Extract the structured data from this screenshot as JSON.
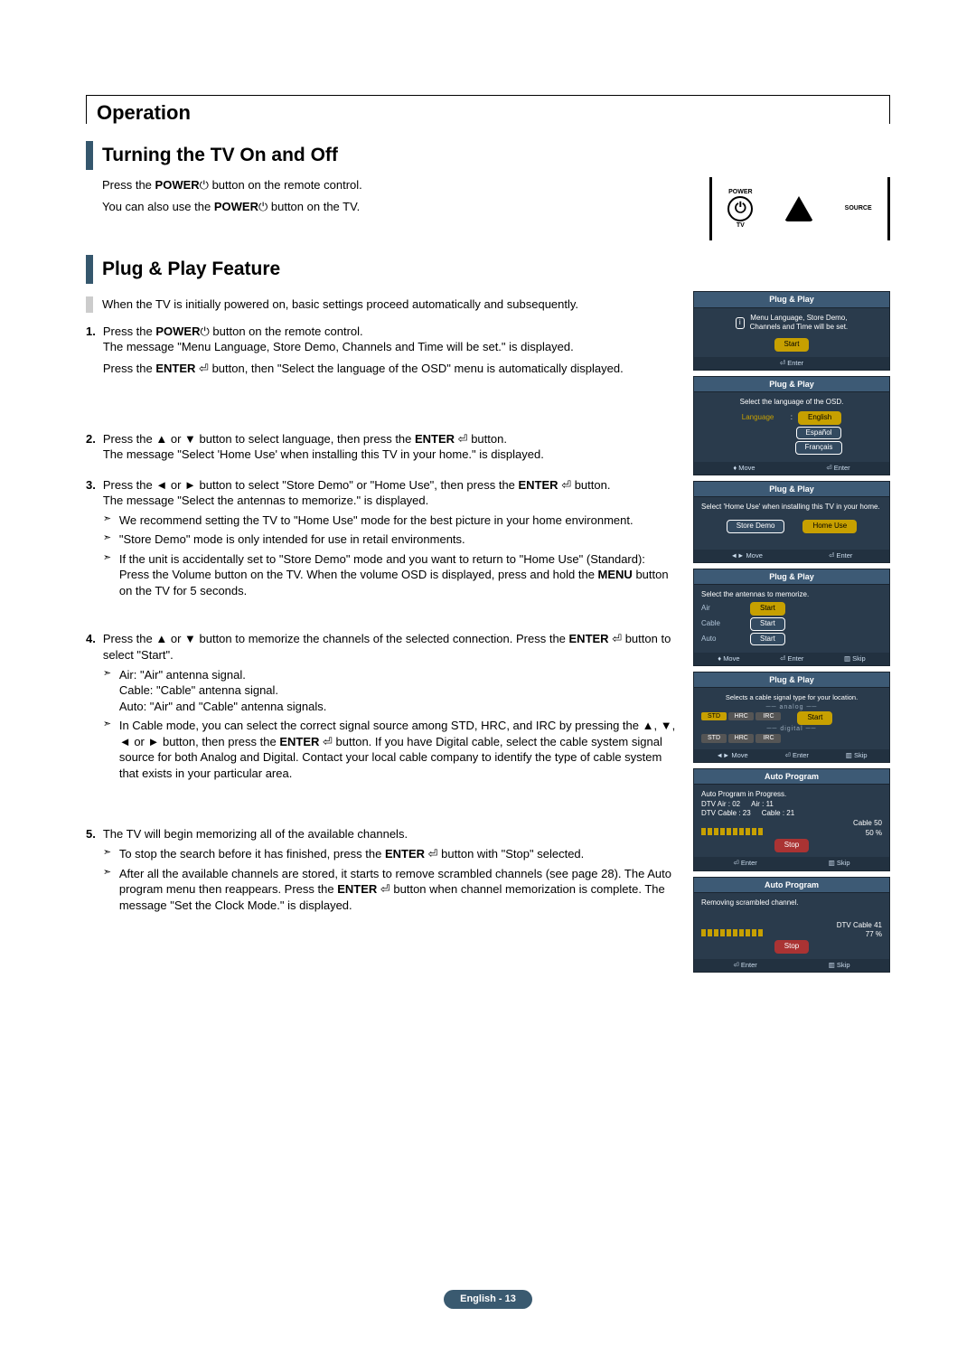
{
  "header": {
    "title": "Operation"
  },
  "section1": {
    "title": "Turning the TV On and Off",
    "line1_pre": "Press the ",
    "line1_bold": "POWER",
    "line1_post": " button on the remote control.",
    "line2_pre": "You can also use the ",
    "line2_bold": "POWER",
    "line2_post": " button on the TV."
  },
  "remote": {
    "power": "POWER",
    "tv": "TV",
    "source": "SOURCE"
  },
  "section2": {
    "title": "Plug & Play Feature",
    "intro": "When the TV is initially powered on, basic settings proceed automatically and subsequently.",
    "step1_a_pre": "Press the ",
    "step1_a_bold": "POWER",
    "step1_a_post": " button on the remote control.",
    "step1_b": "The message \"Menu Language, Store Demo, Channels and Time will be set.\" is displayed.",
    "step1_c_pre": "Press the ",
    "step1_c_bold": "ENTER",
    "step1_c_post": " button, then \"Select the language of the OSD\" menu is automatically displayed.",
    "step2_a_pre": "Press the ▲ or ▼ button to select language, then press the ",
    "step2_a_bold": "ENTER",
    "step2_a_post": " button.",
    "step2_b": "The message \"Select 'Home Use' when installing this TV in your home.\" is displayed.",
    "step3_a_pre": "Press the ◄ or ► button to select \"Store Demo\" or \"Home Use\", then press the ",
    "step3_a_bold": "ENTER",
    "step3_a_post": " button.",
    "step3_b": "The message \"Select the antennas to memorize.\" is displayed.",
    "step3_n1": "We recommend setting the TV to \"Home Use\" mode for the best picture in your home environment.",
    "step3_n2": "\"Store Demo\" mode is only intended for use in retail environments.",
    "step3_n3_pre": "If the unit is accidentally set to \"Store Demo\" mode and you want to return to \"Home Use\" (Standard): Press the Volume button on the TV. When the volume OSD is displayed, press and hold the ",
    "step3_n3_bold": "MENU",
    "step3_n3_post": " button on the TV for 5 seconds.",
    "step4_a_pre": "Press the ▲ or ▼ button to memorize the channels of the selected connection. Press the ",
    "step4_a_bold": "ENTER",
    "step4_a_post": " button to select \"Start\".",
    "step4_n1_l1": "Air: \"Air\" antenna signal.",
    "step4_n1_l2": "Cable: \"Cable\" antenna signal.",
    "step4_n1_l3": "Auto: \"Air\" and \"Cable\" antenna signals.",
    "step4_n2_pre": "In Cable mode, you can select the correct signal source among STD, HRC, and IRC by pressing the ▲, ▼, ◄ or ► button, then press the ",
    "step4_n2_bold": "ENTER",
    "step4_n2_post": " button. If you have Digital cable, select the cable system signal source for both Analog and Digital. Contact your local cable company to identify the type of cable system that exists in your particular area.",
    "step5_a": "The TV will begin memorizing all of the available channels.",
    "step5_n1_pre": "To stop the search before it has finished, press the ",
    "step5_n1_bold": "ENTER",
    "step5_n1_post": " button with \"Stop\" selected.",
    "step5_n2_pre": "After all the available channels are stored, it starts to remove scrambled channels (see page 28). The Auto program menu then reappears. Press the ",
    "step5_n2_bold": "ENTER",
    "step5_n2_post": " button when channel memorization is complete. The message \"Set the Clock Mode.\" is displayed."
  },
  "osd": {
    "t_pp": "Plug & Play",
    "t_ap": "Auto Program",
    "msg1_l1": "Menu Language, Store Demo,",
    "msg1_l2": "Channels and Time will be set.",
    "start": "Start",
    "enter": "Enter",
    "move": "Move",
    "skip": "Skip",
    "msg2": "Select the language of the OSD.",
    "language": "Language",
    "english": "English",
    "espanol": "Español",
    "francais": "Français",
    "msg3": "Select 'Home Use' when installing this TV in your home.",
    "store_demo": "Store Demo",
    "home_use": "Home Use",
    "msg4": "Select the antennas to memorize.",
    "air": "Air",
    "cable": "Cable",
    "auto": "Auto",
    "msg5": "Selects a cable signal type for your location.",
    "analog": "analog",
    "digital": "digital",
    "std": "STD",
    "hrc": "HRC",
    "irc": "IRC",
    "ap_inprog": "Auto Program in Progress.",
    "dtv_air": "DTV Air : 02",
    "air_n": "Air : 11",
    "dtv_cable": "DTV Cable : 23",
    "cable_n": "Cable : 21",
    "cable_50": "Cable   50",
    "pct50": "50   %",
    "stop": "Stop",
    "removing": "Removing scrambled channel.",
    "dtv_cable_41": "DTV Cable   41",
    "pct77": "77   %"
  },
  "footer": {
    "text": "English - 13"
  }
}
